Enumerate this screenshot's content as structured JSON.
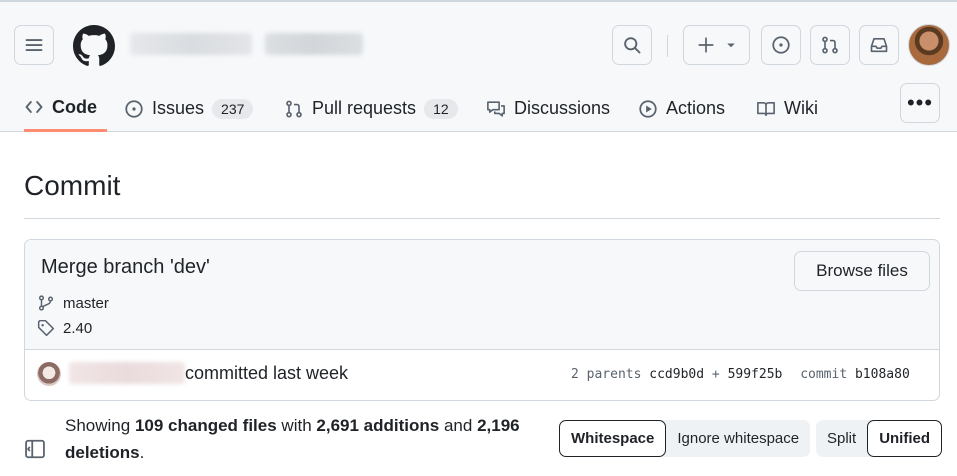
{
  "header": {
    "icons": {
      "menu": "hamburger-icon",
      "logo": "github-mark-icon",
      "search": "search-icon",
      "create": "plus-icon",
      "create_caret": "caret-down-icon",
      "issues": "issue-opened-icon",
      "pulls": "git-pull-request-icon",
      "inbox": "inbox-icon"
    }
  },
  "tabs": [
    {
      "label": "Code",
      "icon": "code-icon",
      "active": true
    },
    {
      "label": "Issues",
      "icon": "issue-opened-icon",
      "count": "237"
    },
    {
      "label": "Pull requests",
      "icon": "git-pull-request-icon",
      "count": "12"
    },
    {
      "label": "Discussions",
      "icon": "comment-discussion-icon"
    },
    {
      "label": "Actions",
      "icon": "play-icon"
    },
    {
      "label": "Wiki",
      "icon": "book-icon"
    }
  ],
  "more_label": "•••",
  "page": {
    "title": "Commit"
  },
  "commit": {
    "message": "Merge branch 'dev'",
    "browse_label": "Browse files",
    "branch": "master",
    "tag": "2.40",
    "committed_text": "committed last week",
    "parents_label": "2 parents",
    "parent_a": "ccd9b0d",
    "plus": "+",
    "parent_b": "599f25b",
    "commit_label": "commit",
    "sha": "b108a80"
  },
  "diff": {
    "showing": "Showing",
    "files_changed": "109 changed files",
    "with": "with",
    "additions": "2,691 additions",
    "and": "and",
    "deletions": "2,196 deletions",
    "period": ".",
    "whitespace_options": [
      "Whitespace",
      "Ignore whitespace"
    ],
    "view_options": [
      "Split",
      "Unified"
    ]
  },
  "colors": {
    "active_tab_underline": "#fd8c73",
    "border": "#d0d7de",
    "header_bg": "#f6f8fa"
  }
}
